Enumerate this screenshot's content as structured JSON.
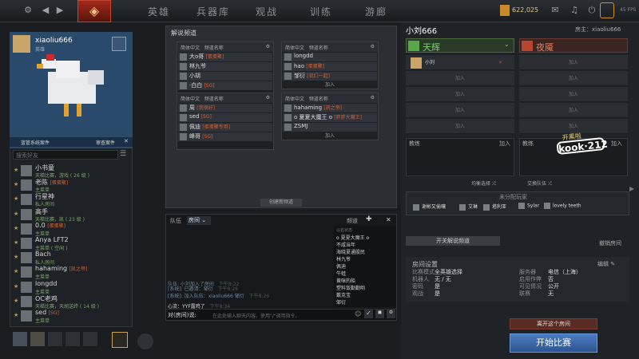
{
  "nav": {
    "tabs": [
      "英雄",
      "兵器库",
      "观战",
      "训练",
      "游廊"
    ],
    "currency": "622,025",
    "fps": "45 FPS"
  },
  "profile": {
    "name": "xiaoliu666",
    "status": "英雄",
    "system_label": "蓝管系统案件",
    "case_button": "审查案件",
    "search_placeholder": "搜索好友"
  },
  "friends": [
    {
      "name": "小书童",
      "tag": "",
      "status": "天梯比赛，游戏 ( 26 级 )"
    },
    {
      "name": "老陈",
      "tag": "[蛋蛋聚]",
      "status": "主菜单"
    },
    {
      "name": "行星神",
      "tag": "",
      "status": "私人房间"
    },
    {
      "name": "高手",
      "tag": "",
      "status": "天梯比赛，凯 ( 23 级 )"
    },
    {
      "name": "0.0",
      "tag": "[蛋蛋聚]",
      "status": "主菜单"
    },
    {
      "name": "Anya LFT2",
      "tag": "",
      "status": "主菜单 ( 空闲 )"
    },
    {
      "name": "Bach",
      "tag": "",
      "status": "私人房间"
    },
    {
      "name": "hahaming",
      "tag": "[凯之帝]",
      "status": "主菜单"
    },
    {
      "name": "longdd",
      "tag": "",
      "status": "主菜单"
    },
    {
      "name": "OC老鸡",
      "tag": "",
      "status": "天梯比赛，天胡送终 ( 14 级 )"
    },
    {
      "name": "sed",
      "tag": "[SG]",
      "status": "主菜单"
    }
  ],
  "broadcast": {
    "title": "解说频道",
    "header_lang": "简体中文",
    "header_name": "频道名称",
    "slots": [
      {
        "rows": [
          {
            "n": "大o哥",
            "t": "[蛋蛋聚]"
          },
          {
            "n": "林九爷",
            "t": ""
          },
          {
            "n": "小胡",
            "t": ""
          },
          {
            "n": "·白白",
            "t": "[SG]"
          }
        ],
        "join": ""
      },
      {
        "rows": [
          {
            "n": "longdd",
            "t": ""
          },
          {
            "n": "hao",
            "t": "[蛋蛋聚]"
          },
          {
            "n": "邹衍",
            "t": "[我们一起]"
          }
        ],
        "join": "加入"
      },
      {
        "rows": [
          {
            "n": "周",
            "t": "[我很好]"
          },
          {
            "n": "sed",
            "t": "[SG]"
          },
          {
            "n": "佩迪",
            "t": "[蛋蛋聚专用]"
          },
          {
            "n": "峰哥",
            "t": "[SG]"
          }
        ],
        "join": ""
      },
      {
        "rows": [
          {
            "n": "hahaming",
            "t": "[凯之帝]"
          },
          {
            "n": "o 夏夏大魔王 o",
            "t": "[胖胖大魔王]"
          },
          {
            "n": "ZSMJ",
            "t": ""
          }
        ],
        "join": "加入"
      }
    ],
    "create_button": "创建新频道"
  },
  "chat": {
    "tab_team": "队伍",
    "tab_room": "房间",
    "broadcast_btn": "频道",
    "lines": [
      {
        "time": "下午8:22",
        "text": "队伍: 小刘加入了房间"
      },
      {
        "time": "下午8:26",
        "text": "[系统]: 已邀请：邹衍"
      },
      {
        "time": "下午8:26",
        "text": "[系统]: 加入队伍：xiaoliu666 邹衍"
      },
      {
        "time": "下午8:34",
        "text": "心流：YYF露鸡了"
      }
    ],
    "members": [
      "o 夏夏大魔王 o",
      "不咸当年",
      "海晓夏通股民",
      "林九爷",
      "佩迪",
      "牛蛙",
      "黄咪的船",
      "塑料饭勤勤哟",
      "戴克宝",
      "邹衍"
    ],
    "members_header": "以名状态",
    "input_prefix": "对(房间)说:",
    "input_placeholder": "在此处输入聊天内容。使用\"/\"调用指令。"
  },
  "lobby": {
    "title": "小刘666",
    "host_label": "房主：xiaoliu666",
    "radiant": "天辉",
    "dire": "夜魇",
    "radiant_players": [
      "小刘",
      "加入",
      "加入",
      "加入",
      "加入"
    ],
    "dire_players": [
      "加入",
      "加入",
      "加入",
      "加入",
      "加入"
    ],
    "coach": "教练",
    "join": "加入",
    "switch_team": "交换队伍",
    "balance": "均衡选择",
    "unassigned_title": "未分配玩家",
    "unassigned": [
      "谢彬又偷嚷",
      "艾琳",
      "塔利亚",
      "Sylar",
      "lovely teeth"
    ],
    "broadcast_btn": "开关解说频道",
    "leave_room": "撤销房间",
    "settings": {
      "title": "房间设置",
      "edit": "编辑",
      "game_mode_label": "比赛模式",
      "game_mode": "全英雄选择",
      "bots_label": "机器人",
      "bots": "无 / 无",
      "password_label": "密码",
      "password": "是",
      "spectate_label": "观战",
      "spectate": "是",
      "server_label": "服务器",
      "server": "电信（上海）",
      "cheats_label": "启用作弊",
      "cheats": "否",
      "visibility_label": "可见情况",
      "visibility": "公开",
      "league_label": "联赛",
      "league": "无"
    },
    "leave_lobby": "离开这个房间",
    "start": "开始比赛"
  },
  "watermark": {
    "brand": "kook·212",
    "sub": "开黑啦"
  },
  "colors": {
    "radiant": "#5aa64a",
    "dire": "#c0472e",
    "start": "#3b69a8",
    "accent_tag": "#c9653b"
  }
}
